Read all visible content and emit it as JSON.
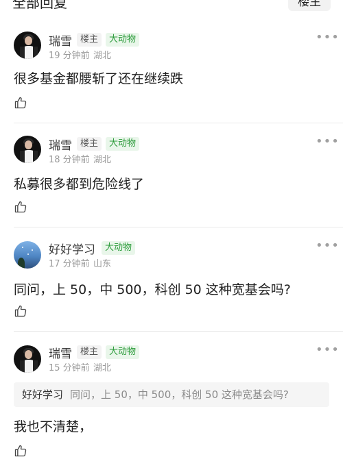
{
  "header": {
    "title": "全部回复",
    "sort_button": "楼主"
  },
  "posts": [
    {
      "user": "瑞雪",
      "owner_badge": "楼主",
      "level": "大动物",
      "time": "19 分钟前",
      "location": "湖北",
      "content": "很多基金都腰斩了还在继续跌"
    },
    {
      "user": "瑞雪",
      "owner_badge": "楼主",
      "level": "大动物",
      "time": "18 分钟前",
      "location": "湖北",
      "content": "私募很多都到危险线了"
    },
    {
      "user": "好好学习",
      "level": "大动物",
      "time": "17 分钟前",
      "location": "山东",
      "content": "同问，上 50，中 500，科创 50 这种宽基会吗?"
    },
    {
      "user": "瑞雪",
      "owner_badge": "楼主",
      "level": "大动物",
      "time": "15 分钟前",
      "location": "湖北",
      "quote_user": "好好学习",
      "quote_text": "同问，上 50，中 500，科创 50 这种宽基会吗?",
      "content": "我也不清楚，"
    }
  ],
  "icons": {
    "more": "more-dots-icon",
    "like": "thumbs-up-icon"
  },
  "colors": {
    "level_badge_text": "#2b9b3a",
    "level_badge_bg": "#e9f6ea",
    "meta": "#9a9a9a"
  }
}
